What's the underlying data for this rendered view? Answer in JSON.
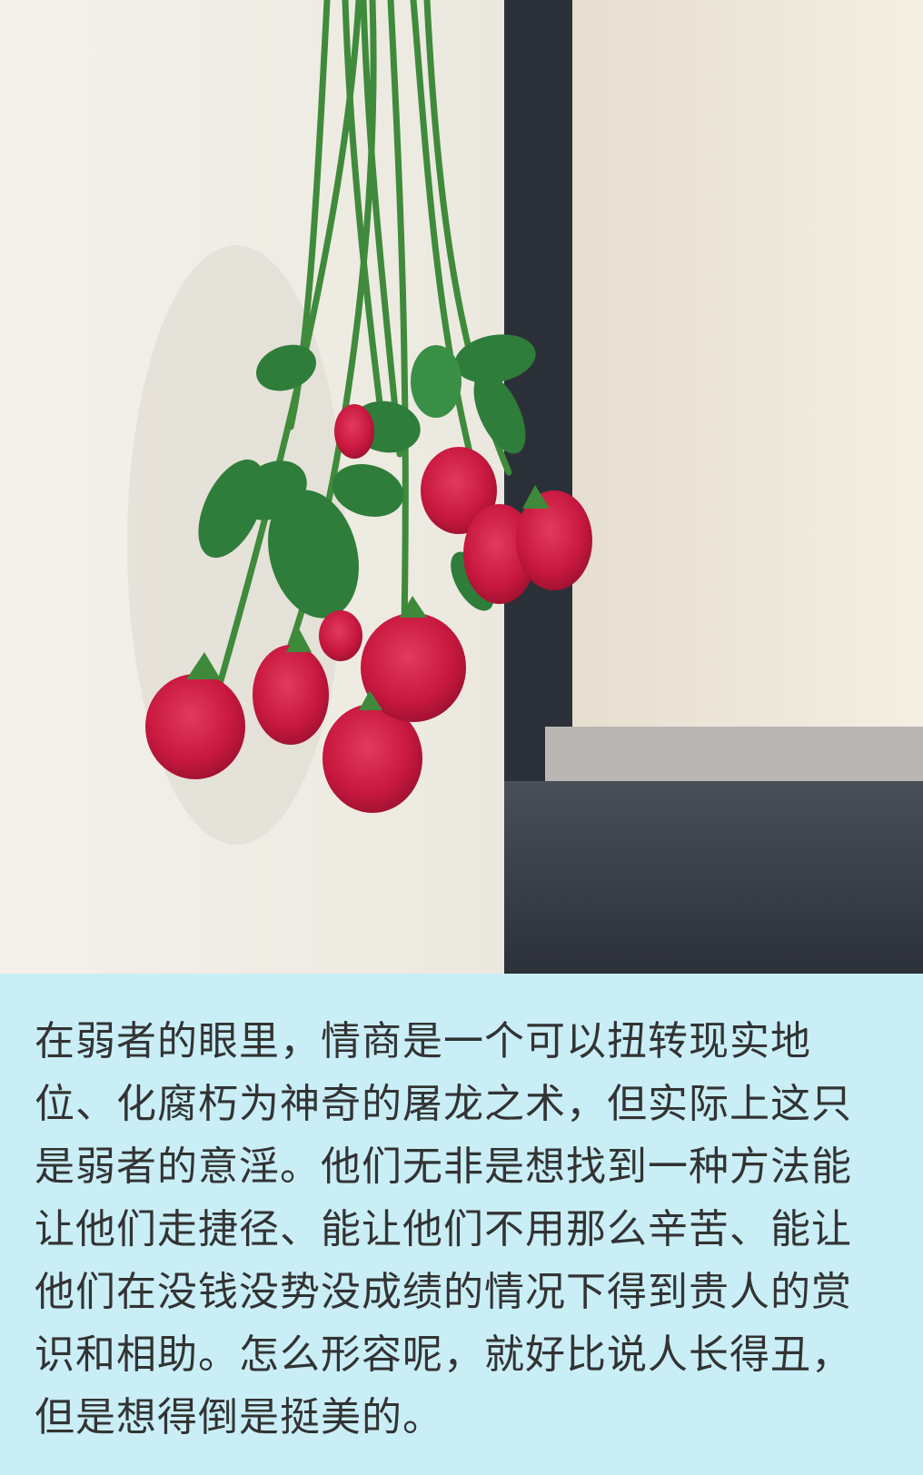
{
  "caption": {
    "text": "在弱者的眼里，情商是一个可以扭转现实地位、化腐朽为神奇的屠龙之术，但实际上这只是弱者的意淫。他们无非是想找到一种方法能让他们走捷径、能让他们不用那么辛苦、能让他们在没钱没势没成绩的情况下得到贵人的赏识和相助。怎么形容呢，就好比说人长得丑，但是想得倒是挺美的。"
  },
  "colors": {
    "panel_background": "#c9eef6",
    "text": "#333333",
    "rose_red": "#c8183f",
    "leaf_green": "#2f7d3a",
    "wall": "#efece4"
  }
}
